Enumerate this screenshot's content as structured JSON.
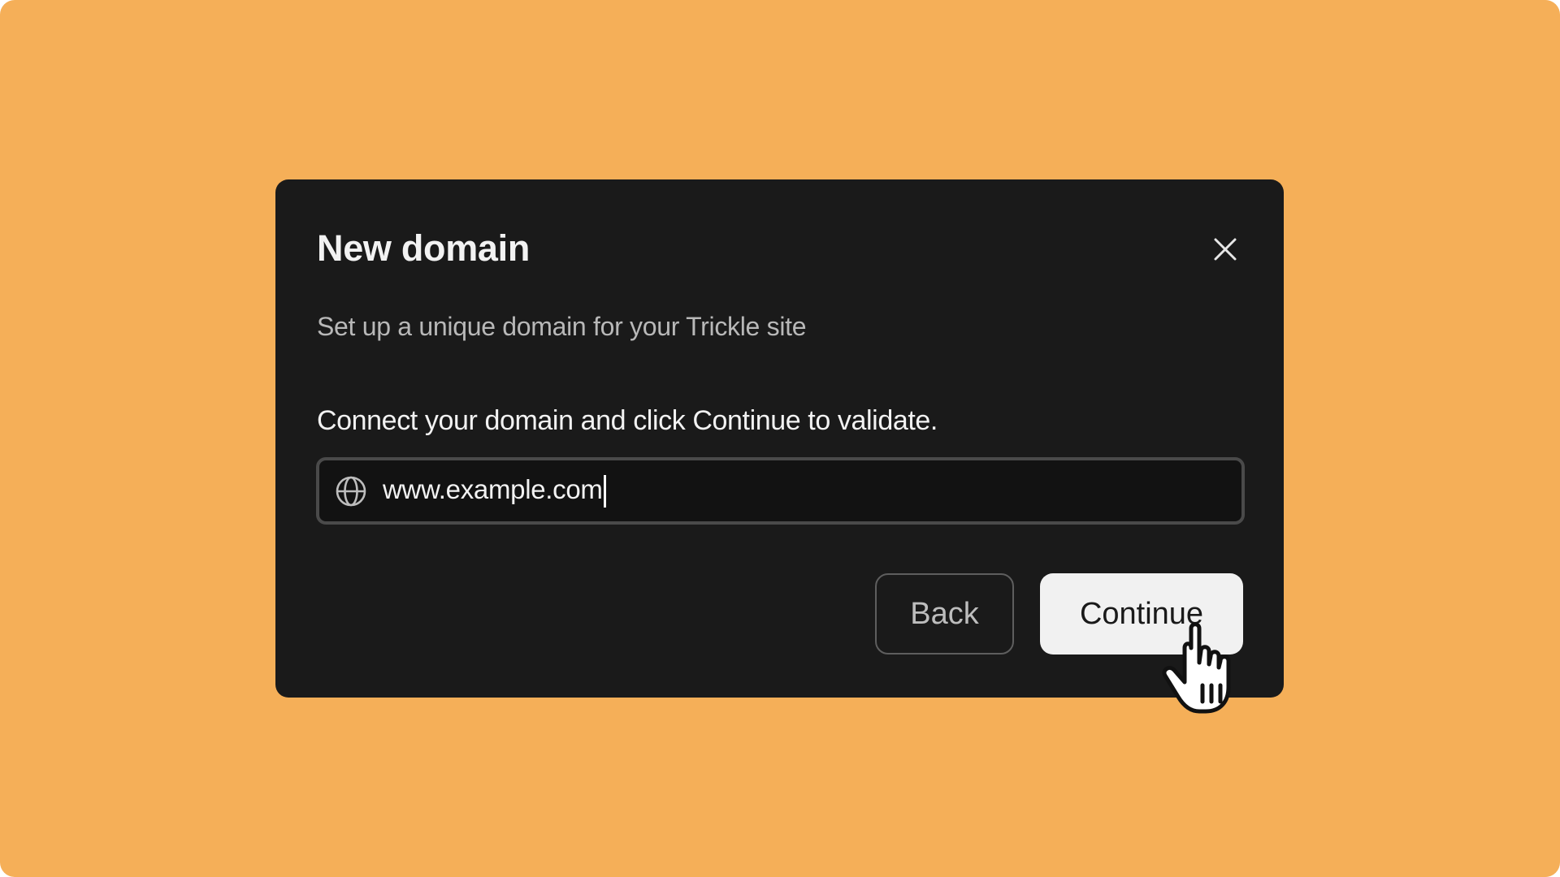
{
  "dialog": {
    "title": "New domain",
    "subtitle": "Set up a unique domain for your Trickle site",
    "instructions": "Connect your domain and click Continue to validate.",
    "close_icon": "close-icon"
  },
  "domain_field": {
    "icon": "globe-icon",
    "value": "www.example.com"
  },
  "actions": {
    "back_label": "Back",
    "continue_label": "Continue"
  },
  "pointer": {
    "icon": "hand-pointer-icon"
  },
  "colors": {
    "background": "#F5AF58",
    "dialog": "#1A1A1A",
    "input_border": "#4A4A4A",
    "primary_button": "#F1F1F1"
  }
}
